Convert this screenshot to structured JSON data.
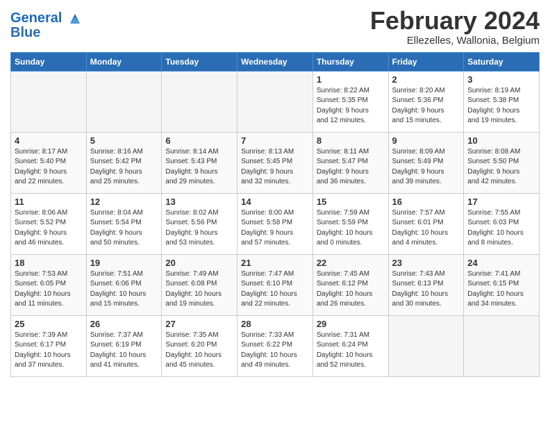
{
  "header": {
    "logo_line1": "General",
    "logo_line2": "Blue",
    "month_year": "February 2024",
    "location": "Ellezelles, Wallonia, Belgium"
  },
  "days_of_week": [
    "Sunday",
    "Monday",
    "Tuesday",
    "Wednesday",
    "Thursday",
    "Friday",
    "Saturday"
  ],
  "weeks": [
    [
      {
        "day": "",
        "info": ""
      },
      {
        "day": "",
        "info": ""
      },
      {
        "day": "",
        "info": ""
      },
      {
        "day": "",
        "info": ""
      },
      {
        "day": "1",
        "info": "Sunrise: 8:22 AM\nSunset: 5:35 PM\nDaylight: 9 hours\nand 12 minutes."
      },
      {
        "day": "2",
        "info": "Sunrise: 8:20 AM\nSunset: 5:36 PM\nDaylight: 9 hours\nand 15 minutes."
      },
      {
        "day": "3",
        "info": "Sunrise: 8:19 AM\nSunset: 5:38 PM\nDaylight: 9 hours\nand 19 minutes."
      }
    ],
    [
      {
        "day": "4",
        "info": "Sunrise: 8:17 AM\nSunset: 5:40 PM\nDaylight: 9 hours\nand 22 minutes."
      },
      {
        "day": "5",
        "info": "Sunrise: 8:16 AM\nSunset: 5:42 PM\nDaylight: 9 hours\nand 25 minutes."
      },
      {
        "day": "6",
        "info": "Sunrise: 8:14 AM\nSunset: 5:43 PM\nDaylight: 9 hours\nand 29 minutes."
      },
      {
        "day": "7",
        "info": "Sunrise: 8:13 AM\nSunset: 5:45 PM\nDaylight: 9 hours\nand 32 minutes."
      },
      {
        "day": "8",
        "info": "Sunrise: 8:11 AM\nSunset: 5:47 PM\nDaylight: 9 hours\nand 36 minutes."
      },
      {
        "day": "9",
        "info": "Sunrise: 8:09 AM\nSunset: 5:49 PM\nDaylight: 9 hours\nand 39 minutes."
      },
      {
        "day": "10",
        "info": "Sunrise: 8:08 AM\nSunset: 5:50 PM\nDaylight: 9 hours\nand 42 minutes."
      }
    ],
    [
      {
        "day": "11",
        "info": "Sunrise: 8:06 AM\nSunset: 5:52 PM\nDaylight: 9 hours\nand 46 minutes."
      },
      {
        "day": "12",
        "info": "Sunrise: 8:04 AM\nSunset: 5:54 PM\nDaylight: 9 hours\nand 50 minutes."
      },
      {
        "day": "13",
        "info": "Sunrise: 8:02 AM\nSunset: 5:56 PM\nDaylight: 9 hours\nand 53 minutes."
      },
      {
        "day": "14",
        "info": "Sunrise: 8:00 AM\nSunset: 5:58 PM\nDaylight: 9 hours\nand 57 minutes."
      },
      {
        "day": "15",
        "info": "Sunrise: 7:59 AM\nSunset: 5:59 PM\nDaylight: 10 hours\nand 0 minutes."
      },
      {
        "day": "16",
        "info": "Sunrise: 7:57 AM\nSunset: 6:01 PM\nDaylight: 10 hours\nand 4 minutes."
      },
      {
        "day": "17",
        "info": "Sunrise: 7:55 AM\nSunset: 6:03 PM\nDaylight: 10 hours\nand 8 minutes."
      }
    ],
    [
      {
        "day": "18",
        "info": "Sunrise: 7:53 AM\nSunset: 6:05 PM\nDaylight: 10 hours\nand 11 minutes."
      },
      {
        "day": "19",
        "info": "Sunrise: 7:51 AM\nSunset: 6:06 PM\nDaylight: 10 hours\nand 15 minutes."
      },
      {
        "day": "20",
        "info": "Sunrise: 7:49 AM\nSunset: 6:08 PM\nDaylight: 10 hours\nand 19 minutes."
      },
      {
        "day": "21",
        "info": "Sunrise: 7:47 AM\nSunset: 6:10 PM\nDaylight: 10 hours\nand 22 minutes."
      },
      {
        "day": "22",
        "info": "Sunrise: 7:45 AM\nSunset: 6:12 PM\nDaylight: 10 hours\nand 26 minutes."
      },
      {
        "day": "23",
        "info": "Sunrise: 7:43 AM\nSunset: 6:13 PM\nDaylight: 10 hours\nand 30 minutes."
      },
      {
        "day": "24",
        "info": "Sunrise: 7:41 AM\nSunset: 6:15 PM\nDaylight: 10 hours\nand 34 minutes."
      }
    ],
    [
      {
        "day": "25",
        "info": "Sunrise: 7:39 AM\nSunset: 6:17 PM\nDaylight: 10 hours\nand 37 minutes."
      },
      {
        "day": "26",
        "info": "Sunrise: 7:37 AM\nSunset: 6:19 PM\nDaylight: 10 hours\nand 41 minutes."
      },
      {
        "day": "27",
        "info": "Sunrise: 7:35 AM\nSunset: 6:20 PM\nDaylight: 10 hours\nand 45 minutes."
      },
      {
        "day": "28",
        "info": "Sunrise: 7:33 AM\nSunset: 6:22 PM\nDaylight: 10 hours\nand 49 minutes."
      },
      {
        "day": "29",
        "info": "Sunrise: 7:31 AM\nSunset: 6:24 PM\nDaylight: 10 hours\nand 52 minutes."
      },
      {
        "day": "",
        "info": ""
      },
      {
        "day": "",
        "info": ""
      }
    ]
  ]
}
